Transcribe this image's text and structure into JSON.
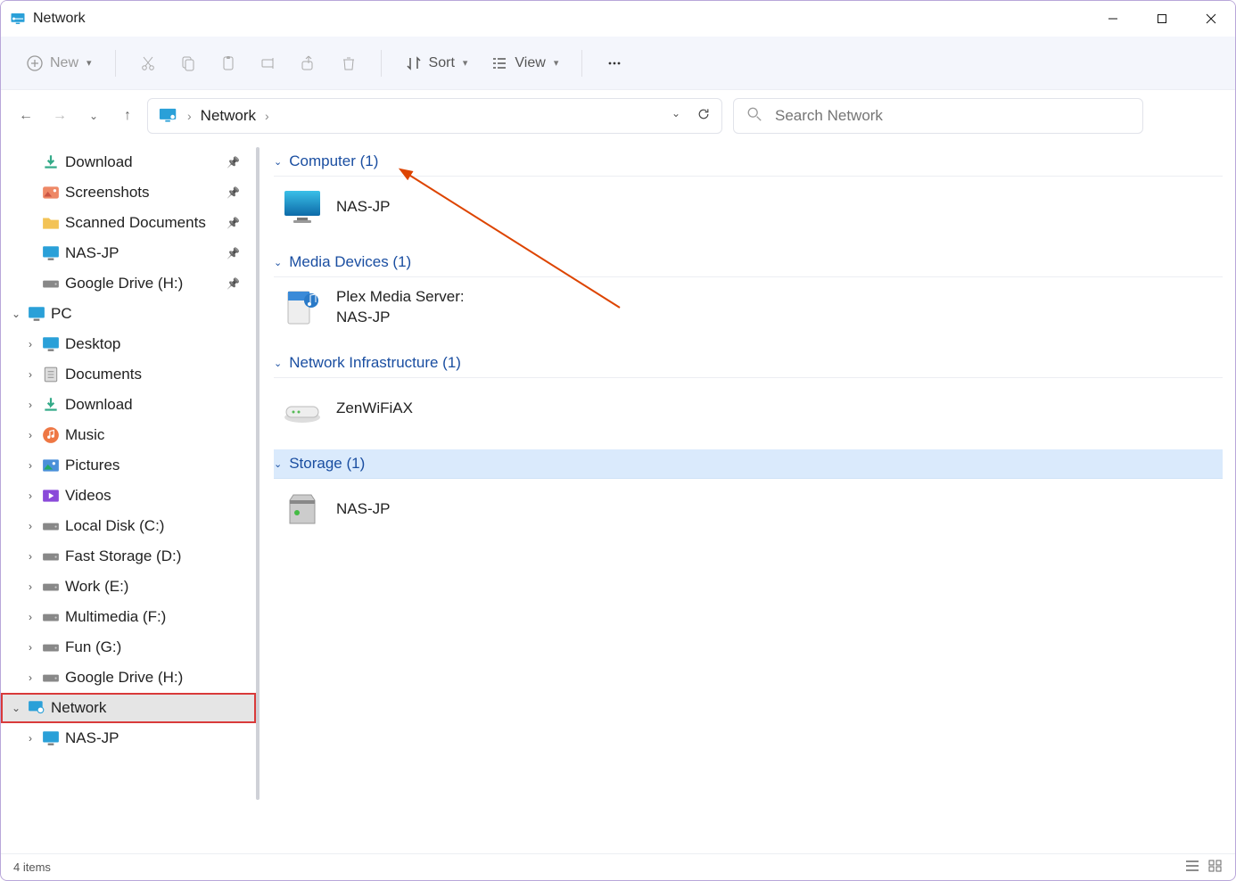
{
  "window": {
    "title": "Network"
  },
  "toolbar": {
    "new_label": "New",
    "sort_label": "Sort",
    "view_label": "View"
  },
  "breadcrumb": {
    "segments": [
      "Network"
    ]
  },
  "search": {
    "placeholder": "Search Network"
  },
  "sidebar": {
    "quick": [
      {
        "label": "Download",
        "icon": "download"
      },
      {
        "label": "Screenshots",
        "icon": "screenshots"
      },
      {
        "label": "Scanned Documents",
        "icon": "folder"
      },
      {
        "label": "NAS-JP",
        "icon": "monitor"
      },
      {
        "label": "Google Drive (H:)",
        "icon": "drive"
      }
    ],
    "pc_label": "PC",
    "pc_children": [
      {
        "label": "Desktop",
        "icon": "desktop"
      },
      {
        "label": "Documents",
        "icon": "documents"
      },
      {
        "label": "Download",
        "icon": "download"
      },
      {
        "label": "Music",
        "icon": "music"
      },
      {
        "label": "Pictures",
        "icon": "pictures"
      },
      {
        "label": "Videos",
        "icon": "videos"
      },
      {
        "label": "Local Disk (C:)",
        "icon": "drive"
      },
      {
        "label": "Fast Storage (D:)",
        "icon": "drive"
      },
      {
        "label": "Work (E:)",
        "icon": "drive"
      },
      {
        "label": "Multimedia (F:)",
        "icon": "drive"
      },
      {
        "label": "Fun (G:)",
        "icon": "drive"
      },
      {
        "label": "Google Drive (H:)",
        "icon": "drive"
      }
    ],
    "network_label": "Network",
    "network_children": [
      {
        "label": "NAS-JP",
        "icon": "monitor"
      }
    ]
  },
  "content": {
    "groups": [
      {
        "header": "Computer (1)",
        "items": [
          {
            "line1": "NAS-JP",
            "icon": "computer"
          }
        ]
      },
      {
        "header": "Media Devices (1)",
        "items": [
          {
            "line1": "Plex Media Server:",
            "line2": "NAS-JP",
            "icon": "media"
          }
        ]
      },
      {
        "header": "Network Infrastructure (1)",
        "items": [
          {
            "line1": "ZenWiFiAX",
            "icon": "router"
          }
        ]
      },
      {
        "header": "Storage (1)",
        "selected": true,
        "items": [
          {
            "line1": "NAS-JP",
            "icon": "storage"
          }
        ]
      }
    ]
  },
  "status": {
    "text": "4 items"
  }
}
